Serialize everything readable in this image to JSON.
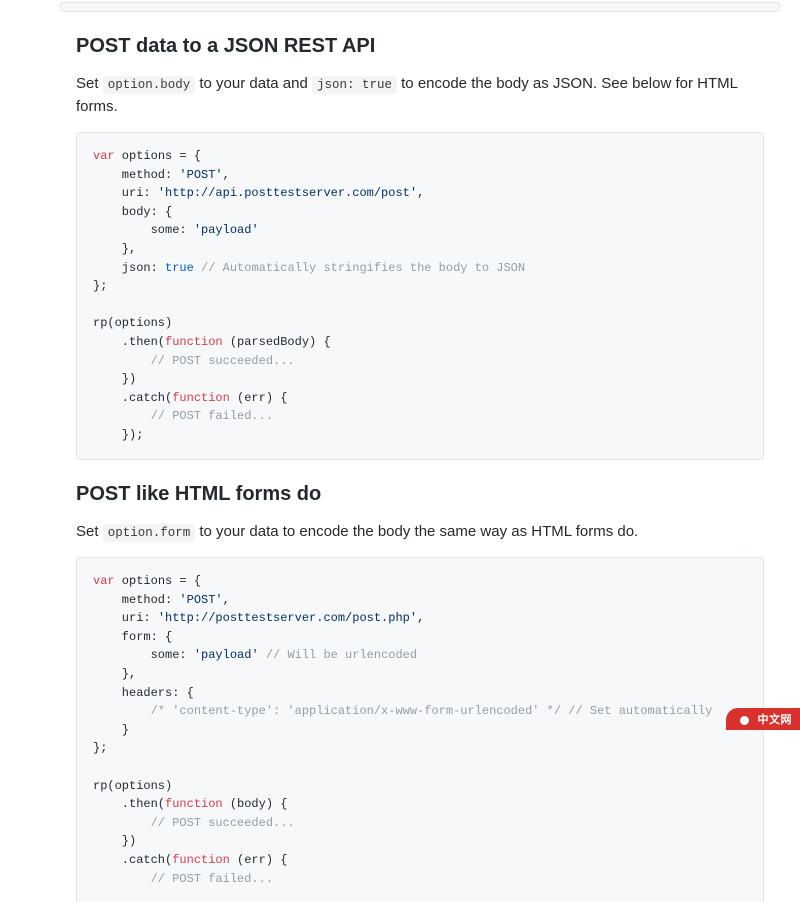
{
  "section1": {
    "heading": "POST data to a JSON REST API",
    "intro_p1": "Set ",
    "intro_code1": "option.body",
    "intro_p2": " to your data and ",
    "intro_code2": "json: true",
    "intro_p3": " to encode the body as JSON. See below for HTML forms.",
    "code": {
      "l01a": "var",
      "l01b": " options = {",
      "l02a": "    method: ",
      "l02b": "'POST'",
      "l02c": ",",
      "l03a": "    uri: ",
      "l03b": "'http://api.posttestserver.com/post'",
      "l03c": ",",
      "l04": "    body: {",
      "l05a": "        some: ",
      "l05b": "'payload'",
      "l06": "    },",
      "l07a": "    json: ",
      "l07b": "true",
      "l07c": " ",
      "l07d": "// Automatically stringifies the body to JSON",
      "l08": "};",
      "l10": "rp(options)",
      "l11a": "    .then(",
      "l11b": "function",
      "l11c": " (parsedBody) {",
      "l12a": "        ",
      "l12b": "// POST succeeded...",
      "l13": "    })",
      "l14a": "    .catch(",
      "l14b": "function",
      "l14c": " (err) {",
      "l15a": "        ",
      "l15b": "// POST failed...",
      "l16": "    });"
    }
  },
  "section2": {
    "heading": "POST like HTML forms do",
    "intro_p1": "Set ",
    "intro_code1": "option.form",
    "intro_p2": " to your data to encode the body the same way as HTML forms do.",
    "code": {
      "l01a": "var",
      "l01b": " options = {",
      "l02a": "    method: ",
      "l02b": "'POST'",
      "l02c": ",",
      "l03a": "    uri: ",
      "l03b": "'http://posttestserver.com/post.php'",
      "l03c": ",",
      "l04": "    form: {",
      "l05a": "        some: ",
      "l05b": "'payload'",
      "l05c": " ",
      "l05d": "// Will be urlencoded",
      "l06": "    },",
      "l07": "    headers: {",
      "l08a": "        ",
      "l08b": "/* 'content-type': 'application/x-www-form-urlencoded' */",
      "l08c": " ",
      "l08d": "// Set automatically",
      "l09": "    }",
      "l10": "};",
      "l12": "rp(options)",
      "l13a": "    .then(",
      "l13b": "function",
      "l13c": " (body) {",
      "l14a": "        ",
      "l14b": "// POST succeeded...",
      "l15": "    })",
      "l16a": "    .catch(",
      "l16b": "function",
      "l16c": " (err) {",
      "l17a": "        ",
      "l17b": "// POST failed..."
    }
  },
  "watermark": "中文网"
}
